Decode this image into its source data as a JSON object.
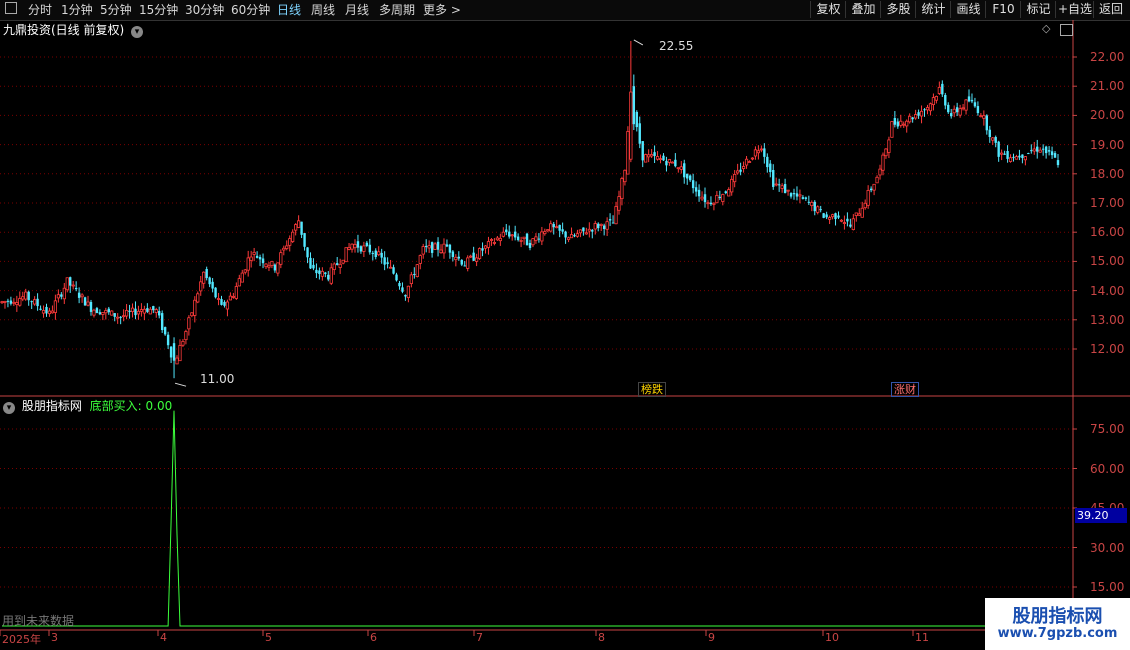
{
  "toolbar": {
    "periods": [
      "分时",
      "1分钟",
      "5分钟",
      "15分钟",
      "30分钟",
      "60分钟",
      "日线",
      "周线",
      "月线",
      "多周期",
      "更多 >"
    ],
    "active_period": "日线",
    "actions": [
      "复权",
      "叠加",
      "多股",
      "统计",
      "画线",
      "F10",
      "标记",
      "+自选",
      "返回"
    ]
  },
  "main_panel": {
    "title": "九鼎投资(日线 前复权)",
    "high_label": "22.55",
    "low_label": "11.00",
    "y_ticks": [
      "22.00",
      "21.00",
      "20.00",
      "19.00",
      "18.00",
      "17.00",
      "16.00",
      "15.00",
      "14.00",
      "13.00",
      "12.00"
    ],
    "tags": [
      {
        "text": "榜跌",
        "color": "#ffd400"
      },
      {
        "text": "涨财",
        "color": "#ff5050"
      }
    ]
  },
  "indicator_panel": {
    "name": "股朋指标网",
    "series_label": "底部买入: 0.00",
    "y_ticks": [
      "75.00",
      "60.00",
      "45.00",
      "30.00",
      "15.00"
    ],
    "cursor_value": "39.20",
    "footer_note": "用到未来数据"
  },
  "date_axis": [
    "2025年",
    "3",
    "4",
    "5",
    "6",
    "7",
    "8",
    "9",
    "10",
    "11"
  ],
  "watermark": {
    "line1": "股朋指标网",
    "line2": "www.7gpzb.com"
  },
  "chart_data": {
    "type": "candlestick",
    "title": "九鼎投资(日线 前复权)",
    "ylim": [
      11.0,
      22.7
    ],
    "notes": "approximate daily OHLC read from the picture",
    "candles": []
  },
  "colors": {
    "up": "#ff3b3b",
    "down": "#52e8ff",
    "grid": "#7a0000",
    "axis": "#c94545",
    "indicator": "#3cff3c"
  }
}
